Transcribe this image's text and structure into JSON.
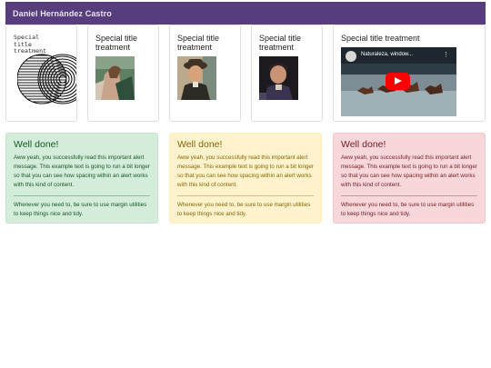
{
  "navbar": {
    "brand": "Daniel Hernández Castro"
  },
  "cards": [
    {
      "title": "Special title treatment"
    },
    {
      "title": "Special title treatment"
    },
    {
      "title": "Special title treatment"
    },
    {
      "title": "Special title treatment"
    },
    {
      "title": "Special title treatment"
    }
  ],
  "video": {
    "title": "Naturaleza, window...",
    "menu_icon": "more-vert-icon",
    "play_icon": "youtube-play-icon"
  },
  "alerts": [
    {
      "heading": "Well done!",
      "text": "Aww yeah, you successfully read this important alert message. This example text is going to run a bit longer so that you can see how spacing within an alert works with this kind of content.",
      "footer": "Whenever you need to, be sure to use margin utilities to keep things nice and tidy.",
      "color": "#155724"
    },
    {
      "heading": "Well done!",
      "text": "Aww yeah, you successfully read this important alert message. This example text is going to run a bit longer so that you can see how spacing within an alert works with this kind of content.",
      "footer": "Whenever you need to, be sure to use margin utilities to keep things nice and tidy.",
      "color": "#856404"
    },
    {
      "heading": "Well done!",
      "text": "Aww yeah, you successfully read this important alert message. This example text is going to run a bit longer so that you can see how spacing within an alert works with this kind of content.",
      "footer": "Whenever you need to, be sure to use margin utilities to keep things nice and tidy.",
      "color": "#721c24"
    }
  ],
  "colors": {
    "navbar": "#563d7c",
    "play_button": "#ff0000"
  }
}
